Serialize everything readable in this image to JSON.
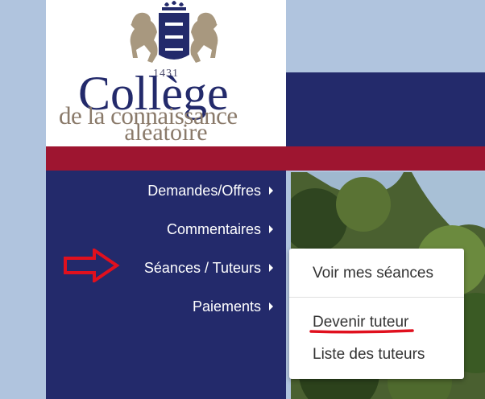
{
  "logo": {
    "year": "1431",
    "word": "Collège",
    "subtitle_line1": "de la connaissance",
    "subtitle_line2": "aléatoire"
  },
  "nav": {
    "items": [
      {
        "label": "Demandes/Offres"
      },
      {
        "label": "Commentaires"
      },
      {
        "label": "Séances / Tuteurs"
      },
      {
        "label": "Paiements"
      }
    ]
  },
  "dropdown": {
    "items": [
      {
        "label": "Voir mes séances"
      },
      {
        "label": "Devenir tuteur"
      },
      {
        "label": "Liste des tuteurs"
      }
    ]
  },
  "colors": {
    "navy": "#232a6b",
    "crimson": "#9e1530",
    "page_background": "#b0c4de",
    "annotation_red": "#e0101e"
  },
  "icons": [
    "crest-icon",
    "menu-arrow-icon",
    "pointer-arrow-icon"
  ]
}
